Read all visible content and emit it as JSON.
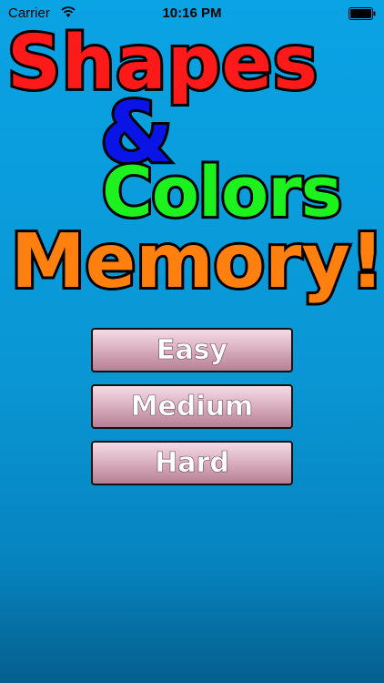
{
  "status_bar": {
    "carrier": "Carrier",
    "time": "10:16 PM",
    "wifi_icon": "wifi-icon",
    "battery_icon": "battery-icon"
  },
  "title": {
    "line1": "Shapes",
    "line2": "&",
    "line3": "Colors",
    "line4": "Memory!"
  },
  "title_colors": {
    "shapes": "#ff1a1a",
    "ampersand": "#0a14e6",
    "colors": "#1ef21e",
    "memory": "#ff7f0f"
  },
  "menu": {
    "easy_label": "Easy",
    "medium_label": "Medium",
    "hard_label": "Hard"
  },
  "background_color": "#0a9ad8"
}
